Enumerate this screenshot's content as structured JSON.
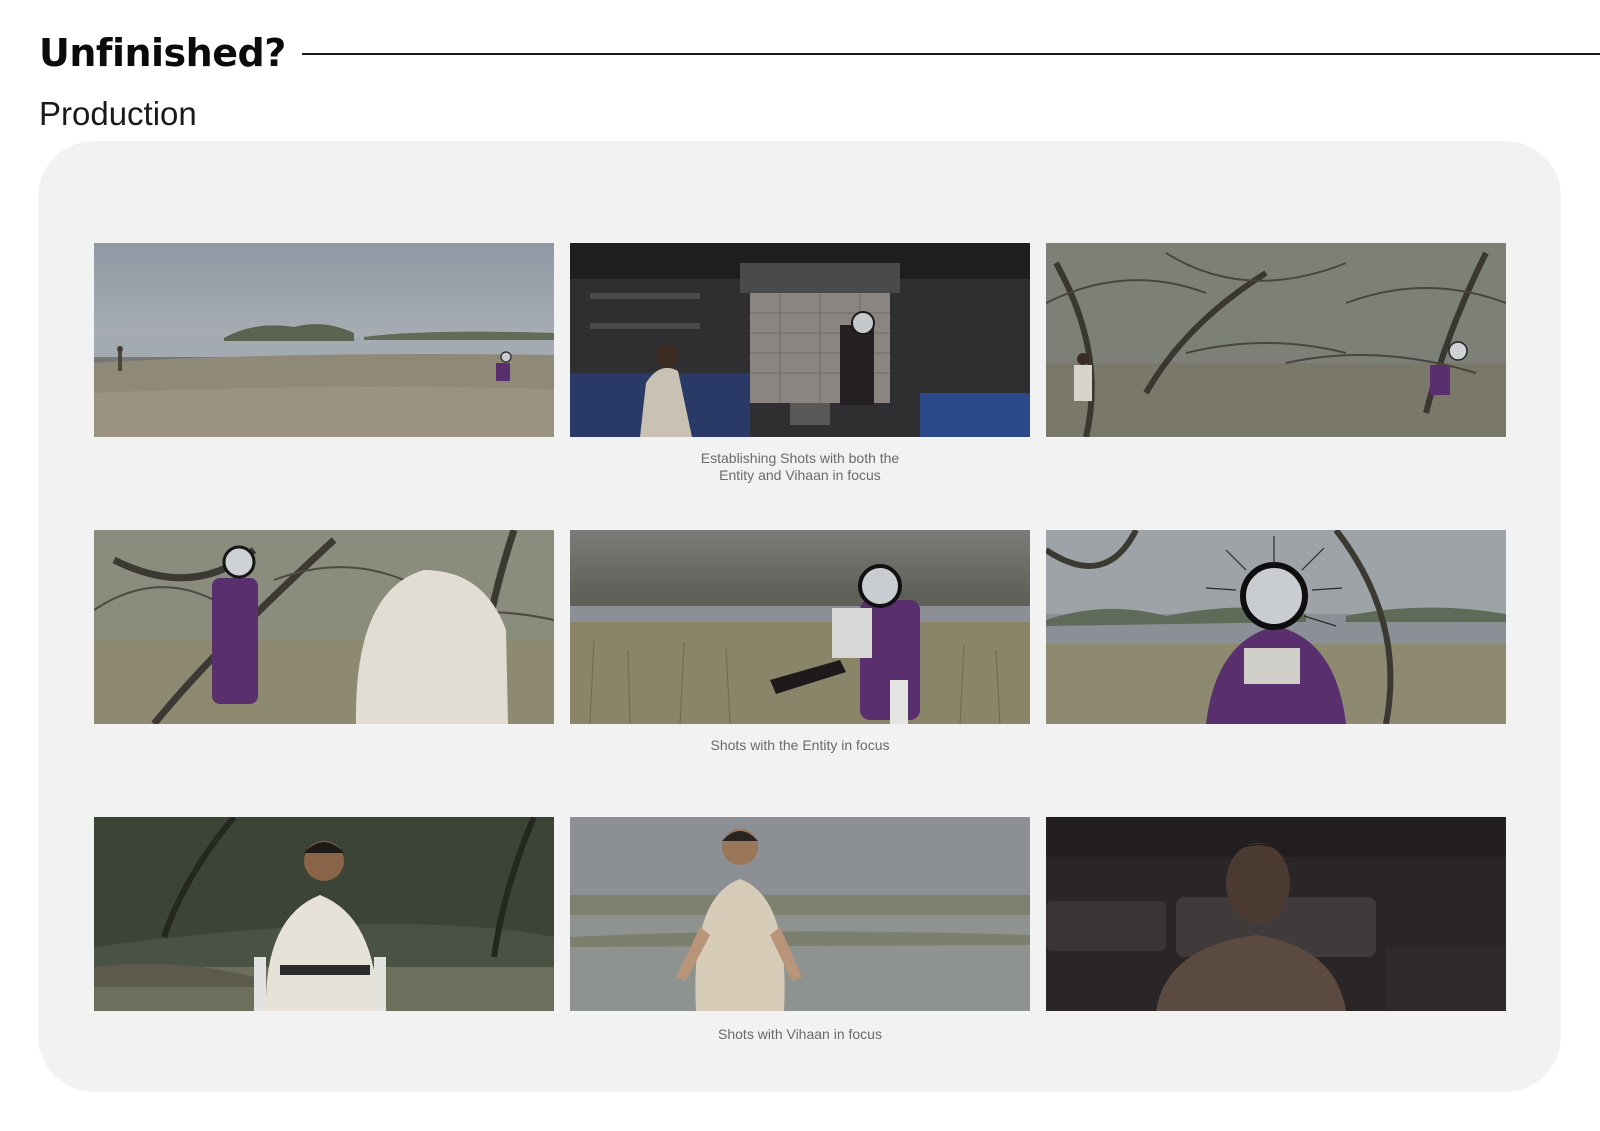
{
  "page": {
    "title": "Unfinished?",
    "subtitle": "Production"
  },
  "groups": [
    {
      "caption": "Establishing Shots with both the\nEntity and Vihaan in focus",
      "shots": [
        {
          "alt": "Wide riverbank shot with Vihaan standing left and the Entity seated right"
        },
        {
          "alt": "Dim kitchen interior with Vihaan seated and the Entity standing"
        },
        {
          "alt": "Grove of bare trees with Vihaan and the Entity seated far apart"
        }
      ]
    },
    {
      "caption": "Shots with the Entity in focus",
      "shots": [
        {
          "alt": "The Entity in purple robe leaning on a tree, Vihaan in foreground"
        },
        {
          "alt": "The Entity seated in tall grass reading a paper"
        },
        {
          "alt": "Close shot of the Entity with antenna-like mirror head, seated"
        }
      ]
    },
    {
      "caption": "Shots with Vihaan in focus",
      "shots": [
        {
          "alt": "Vihaan seated on a white chair among trees"
        },
        {
          "alt": "Vihaan standing in a pale shirt by the water"
        },
        {
          "alt": "Dark close-up of Vihaan's face"
        }
      ]
    }
  ],
  "colors": {
    "panel_background": "#f2f2f2",
    "caption_text": "#6a6a6a",
    "entity_robe": "#5a2f6e",
    "rule": "#1a1a1a"
  }
}
